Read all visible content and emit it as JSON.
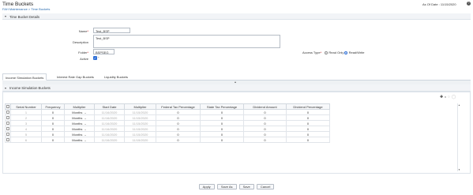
{
  "header": {
    "title": "Time Buckets",
    "breadcrumb": "FAH Maintenance > Time Buckets",
    "as_of_date": "As Of Date : 11/15/2020",
    "help_glyph": "?"
  },
  "details": {
    "section_title": "Time Bucket Details",
    "name_label": "Name",
    "name_value": "Test_BSP",
    "description_label": "Description",
    "description_value": "Test_BSP",
    "folder_label": "Folder",
    "folder_value": "BSPSEG",
    "active_label": "Active",
    "access_type_label": "Access Type",
    "access_read_only": "Read Only",
    "access_read_write": "Read/Write"
  },
  "tabs": [
    {
      "label": "Income Simulation Buckets"
    },
    {
      "label": "Interest Rate Gap Buckets"
    },
    {
      "label": "Liquidity Buckets"
    }
  ],
  "grid": {
    "section_title": "Income Simulation Buckets",
    "toolbar_icons": [
      "add-icon",
      "dropdown-icon",
      "delete-icon",
      "view-icon"
    ],
    "columns": [
      "Serial Number",
      "Frequency",
      "Multiplier",
      "Start Date",
      "Multiplier",
      "Federal Tax Percentage",
      "State Tax Percentage",
      "Dividend Amount",
      "Dividend Percentage"
    ],
    "rows": [
      {
        "serial": "1",
        "frequency": "0",
        "multiplier": "Months",
        "start_date": "11/16/2020",
        "multiplier2": "11/15/2020",
        "federal": "0",
        "state": "0",
        "div_amount": "0",
        "div_pct": "0"
      },
      {
        "serial": "2",
        "frequency": "0",
        "multiplier": "Months",
        "start_date": "11/16/2020",
        "multiplier2": "11/15/2020",
        "federal": "0",
        "state": "0",
        "div_amount": "0",
        "div_pct": "0"
      },
      {
        "serial": "3",
        "frequency": "0",
        "multiplier": "Months",
        "start_date": "11/16/2020",
        "multiplier2": "11/15/2020",
        "federal": "0",
        "state": "0",
        "div_amount": "0",
        "div_pct": "0"
      },
      {
        "serial": "4",
        "frequency": "0",
        "multiplier": "Months",
        "start_date": "11/16/2020",
        "multiplier2": "11/15/2020",
        "federal": "0",
        "state": "0",
        "div_amount": "0",
        "div_pct": "0"
      },
      {
        "serial": "5",
        "frequency": "0",
        "multiplier": "Months",
        "start_date": "11/16/2020",
        "multiplier2": "11/15/2020",
        "federal": "0",
        "state": "0",
        "div_amount": "0",
        "div_pct": "0"
      },
      {
        "serial": "6",
        "frequency": "0",
        "multiplier": "Months",
        "start_date": "11/16/2020",
        "multiplier2": "11/15/2020",
        "federal": "0",
        "state": "0",
        "div_amount": "0",
        "div_pct": "0"
      }
    ]
  },
  "footer": {
    "apply": "Apply",
    "save_as": "Save As",
    "save": "Save",
    "cancel": "Cancel"
  },
  "colors": {
    "accent": "#2f6fd6",
    "link": "#2b6cb0"
  }
}
